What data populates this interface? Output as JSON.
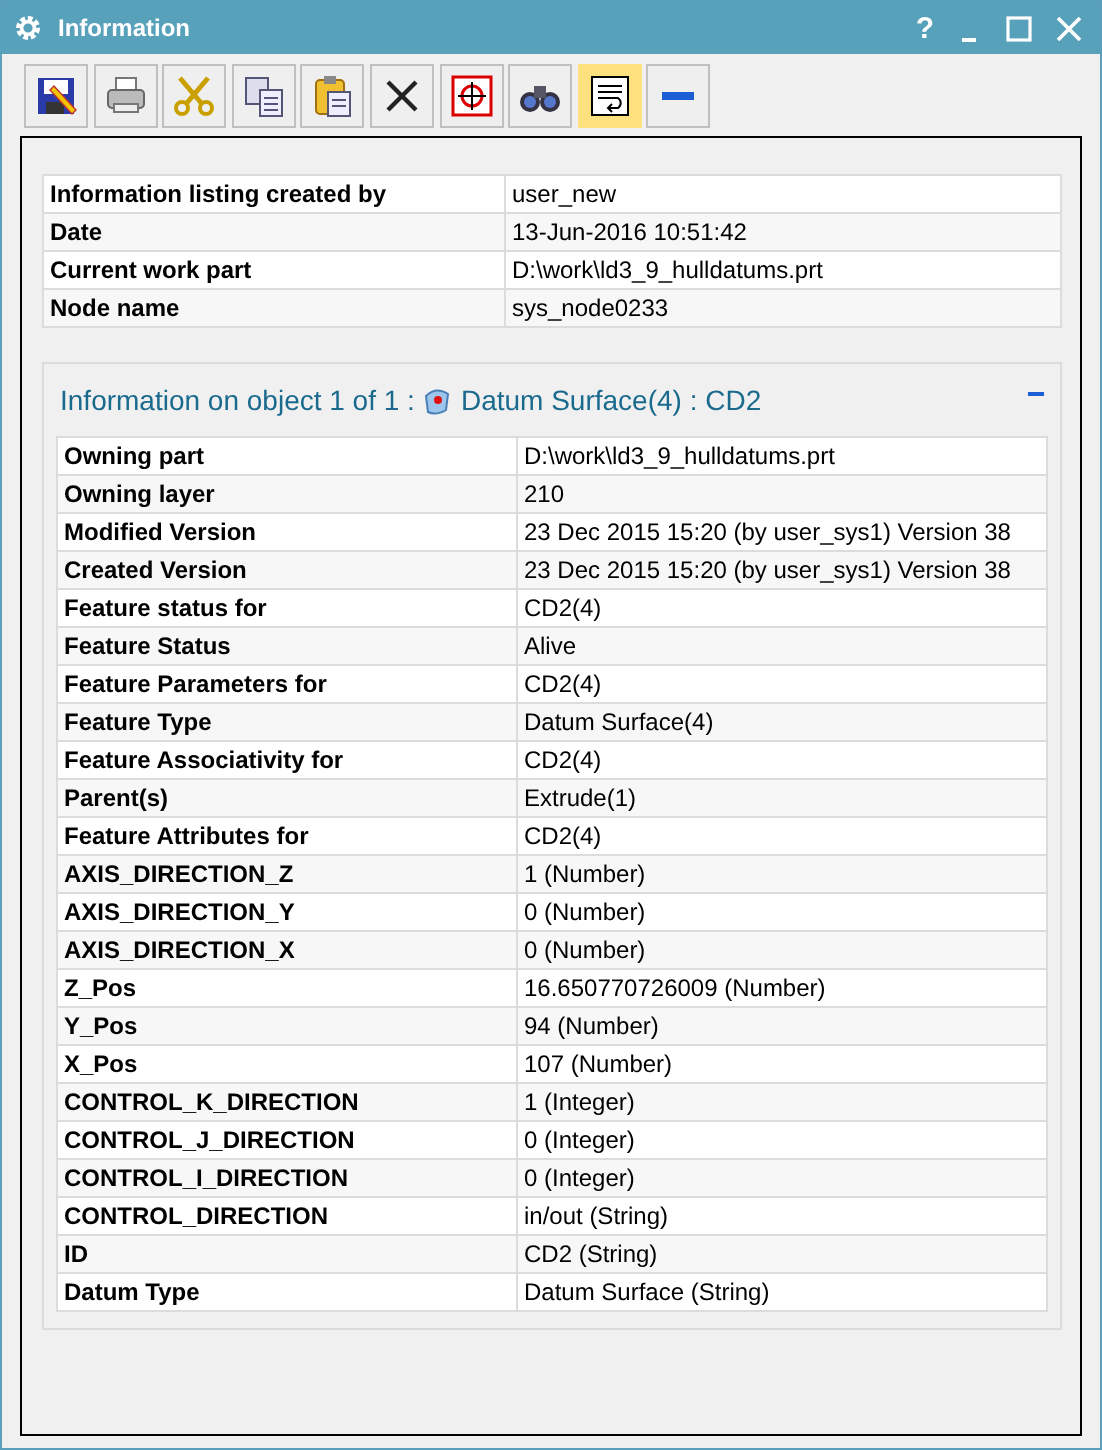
{
  "window": {
    "title": "Information",
    "controls": [
      {
        "kind": "help",
        "label": "?"
      },
      {
        "kind": "minimize"
      },
      {
        "kind": "maximize"
      },
      {
        "kind": "close"
      }
    ]
  },
  "toolbar": [
    {
      "kind": "save",
      "selected": false
    },
    {
      "kind": "print",
      "selected": false
    },
    {
      "kind": "cut",
      "selected": false
    },
    {
      "kind": "copy",
      "selected": false
    },
    {
      "kind": "paste",
      "selected": false
    },
    {
      "kind": "delete",
      "selected": false
    },
    {
      "kind": "target",
      "selected": false
    },
    {
      "kind": "find",
      "selected": false
    },
    {
      "kind": "wrap",
      "selected": true
    },
    {
      "kind": "collapse",
      "selected": false
    }
  ],
  "header_table": [
    {
      "key": "Information listing created by",
      "value": "user_new"
    },
    {
      "key": "Date",
      "value": "13-Jun-2016 10:51:42"
    },
    {
      "key": "Current work part",
      "value": "D:\\work\\ld3_9_hulldatums.prt"
    },
    {
      "key": "Node name",
      "value": "sys_node0233"
    }
  ],
  "object_section": {
    "title_prefix": "Information on object 1 of 1 :",
    "title_object": "Datum Surface(4) : CD2",
    "expanded": true,
    "rows": [
      {
        "key": "Owning part",
        "value": "D:\\work\\ld3_9_hulldatums.prt"
      },
      {
        "key": "Owning layer",
        "value": "210"
      },
      {
        "key": "Modified Version",
        "value": "23 Dec 2015 15:20 (by user_sys1) Version 38"
      },
      {
        "key": "Created Version",
        "value": "23 Dec 2015 15:20 (by user_sys1) Version 38"
      },
      {
        "key": "Feature status for",
        "value": "CD2(4)"
      },
      {
        "key": "Feature Status",
        "value": "Alive"
      },
      {
        "key": "Feature Parameters for",
        "value": "CD2(4)"
      },
      {
        "key": "Feature Type",
        "value": "Datum Surface(4)"
      },
      {
        "key": "Feature Associativity for",
        "value": "CD2(4)"
      },
      {
        "key": "Parent(s)",
        "value": "Extrude(1)"
      },
      {
        "key": "Feature Attributes for",
        "value": "CD2(4)"
      },
      {
        "key": "AXIS_DIRECTION_Z",
        "value": "1 (Number)"
      },
      {
        "key": "AXIS_DIRECTION_Y",
        "value": "0 (Number)"
      },
      {
        "key": "AXIS_DIRECTION_X",
        "value": "0 (Number)"
      },
      {
        "key": "Z_Pos",
        "value": "16.650770726009 (Number)"
      },
      {
        "key": "Y_Pos",
        "value": "94 (Number)"
      },
      {
        "key": "X_Pos",
        "value": "107 (Number)"
      },
      {
        "key": "CONTROL_K_DIRECTION",
        "value": "1 (Integer)"
      },
      {
        "key": "CONTROL_J_DIRECTION",
        "value": "0 (Integer)"
      },
      {
        "key": "CONTROL_I_DIRECTION",
        "value": "0 (Integer)"
      },
      {
        "key": "CONTROL_DIRECTION",
        "value": "in/out (String)"
      },
      {
        "key": "ID",
        "value": "CD2 (String)"
      },
      {
        "key": "Datum Type",
        "value": "Datum Surface (String)"
      }
    ]
  }
}
